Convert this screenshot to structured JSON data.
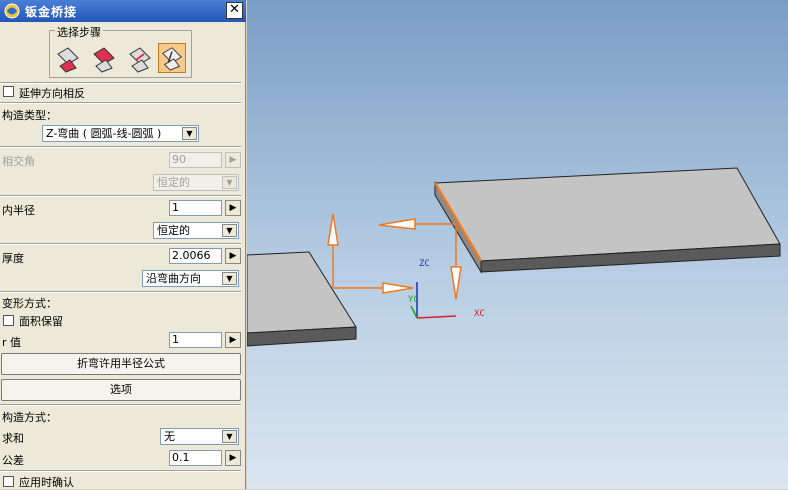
{
  "dialog": {
    "title": "钣金桥接",
    "close_glyph": "✕",
    "steps_group": {
      "label": "选择步骤",
      "icons": [
        "step-1-icon",
        "step-2-icon",
        "step-3-icon",
        "step-4-icon"
      ],
      "active_index": 3
    },
    "reverse_extension": {
      "label": "延伸方向相反",
      "checked": false
    },
    "construction_type": {
      "label": "构造类型：",
      "value": "Z-弯曲 ( 圆弧-线-圆弧 )"
    },
    "intersection_angle": {
      "label": "相交角",
      "value": "90",
      "mode": "恒定的"
    },
    "inner_radius": {
      "label": "内半径",
      "value": "1",
      "mode": "恒定的"
    },
    "thickness": {
      "label": "厚度",
      "value": "2.0066",
      "mode": "沿弯曲方向"
    },
    "deformation": {
      "label": "变形方式：",
      "area_preserve": {
        "label": "面积保留",
        "checked": false
      },
      "r_value": {
        "label": "r 值",
        "value": "1"
      }
    },
    "bend_formula_button": "折弯许用半径公式",
    "options_button": "选项",
    "construction_method": {
      "label": "构造方式：",
      "sum": {
        "label": "求和",
        "value": "无"
      },
      "tolerance": {
        "label": "公差",
        "value": "0.1"
      }
    },
    "confirm_on_apply": {
      "label": "应用时确认",
      "checked": false
    },
    "spin_glyph": "▶",
    "dropdown_glyph": "▼"
  },
  "viewport": {
    "axes": {
      "z_label": "ZC",
      "y_label": "YC",
      "x_label": "XC"
    },
    "colors": {
      "handle": "#f07820",
      "plate_top": "#c4c4c4",
      "plate_side": "#5a5a5a",
      "axis_x": "#e02020",
      "axis_y": "#20a020",
      "axis_z": "#2030c0"
    }
  }
}
